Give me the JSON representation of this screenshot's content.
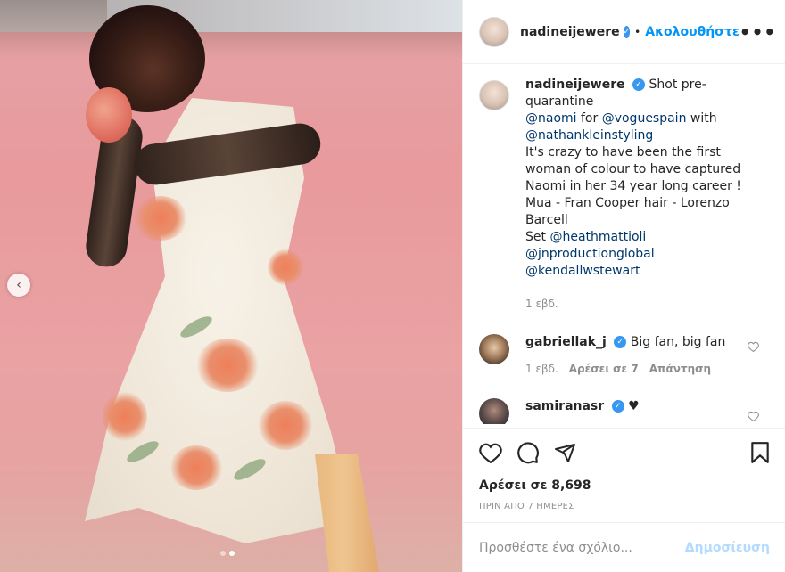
{
  "post": {
    "author": "nadineijewere",
    "follow_label": "Ακολουθήστε",
    "bullet": "•",
    "more": "•••"
  },
  "caption": {
    "username": "nadineijewere",
    "line1": "Shot pre-quarantine",
    "mention_naomi": "@naomi",
    "for_text": "for",
    "mention_voguespain": "@voguespain",
    "with_text": "with",
    "mention_nathan": "@nathankleinstyling",
    "text1": "It's crazy to have been the first woman of colour to have captured Naomi in her 34 year long career !",
    "text2": "Mua - Fran Cooper hair - Lorenzo Barcell",
    "set_text": "Set",
    "mention_heath": "@heathmattioli",
    "mention_jn": "@jnproductionglobal",
    "mention_kendall": "@kendallwstewart",
    "time": "1 εβδ."
  },
  "comments": [
    {
      "username": "gabriellak_j",
      "text": "Big fan, big fan",
      "time": "1 εβδ.",
      "likes": "Αρέσει σε 7",
      "reply": "Απάντηση",
      "avatar_color": "#4a3a2a"
    },
    {
      "username": "samiranasr",
      "text": "♥",
      "avatar_color": "#2c2c34"
    }
  ],
  "likes_text": "Αρέσει σε 8,698",
  "posted_text": "ΠΡΙΝ ΑΠΟ 7 ΗΜΕΡΕΣ",
  "add_comment": {
    "placeholder": "Προσθέστε ένα σχόλιο...",
    "post_label": "Δημοσίευση"
  },
  "carousel": {
    "prev_glyph": "‹",
    "dots_total": 2,
    "active_dot": 2
  },
  "colors": {
    "link": "#00376b",
    "follow": "#0095f6",
    "verified": "#3897f0",
    "post_disabled": "#b3dbff"
  }
}
